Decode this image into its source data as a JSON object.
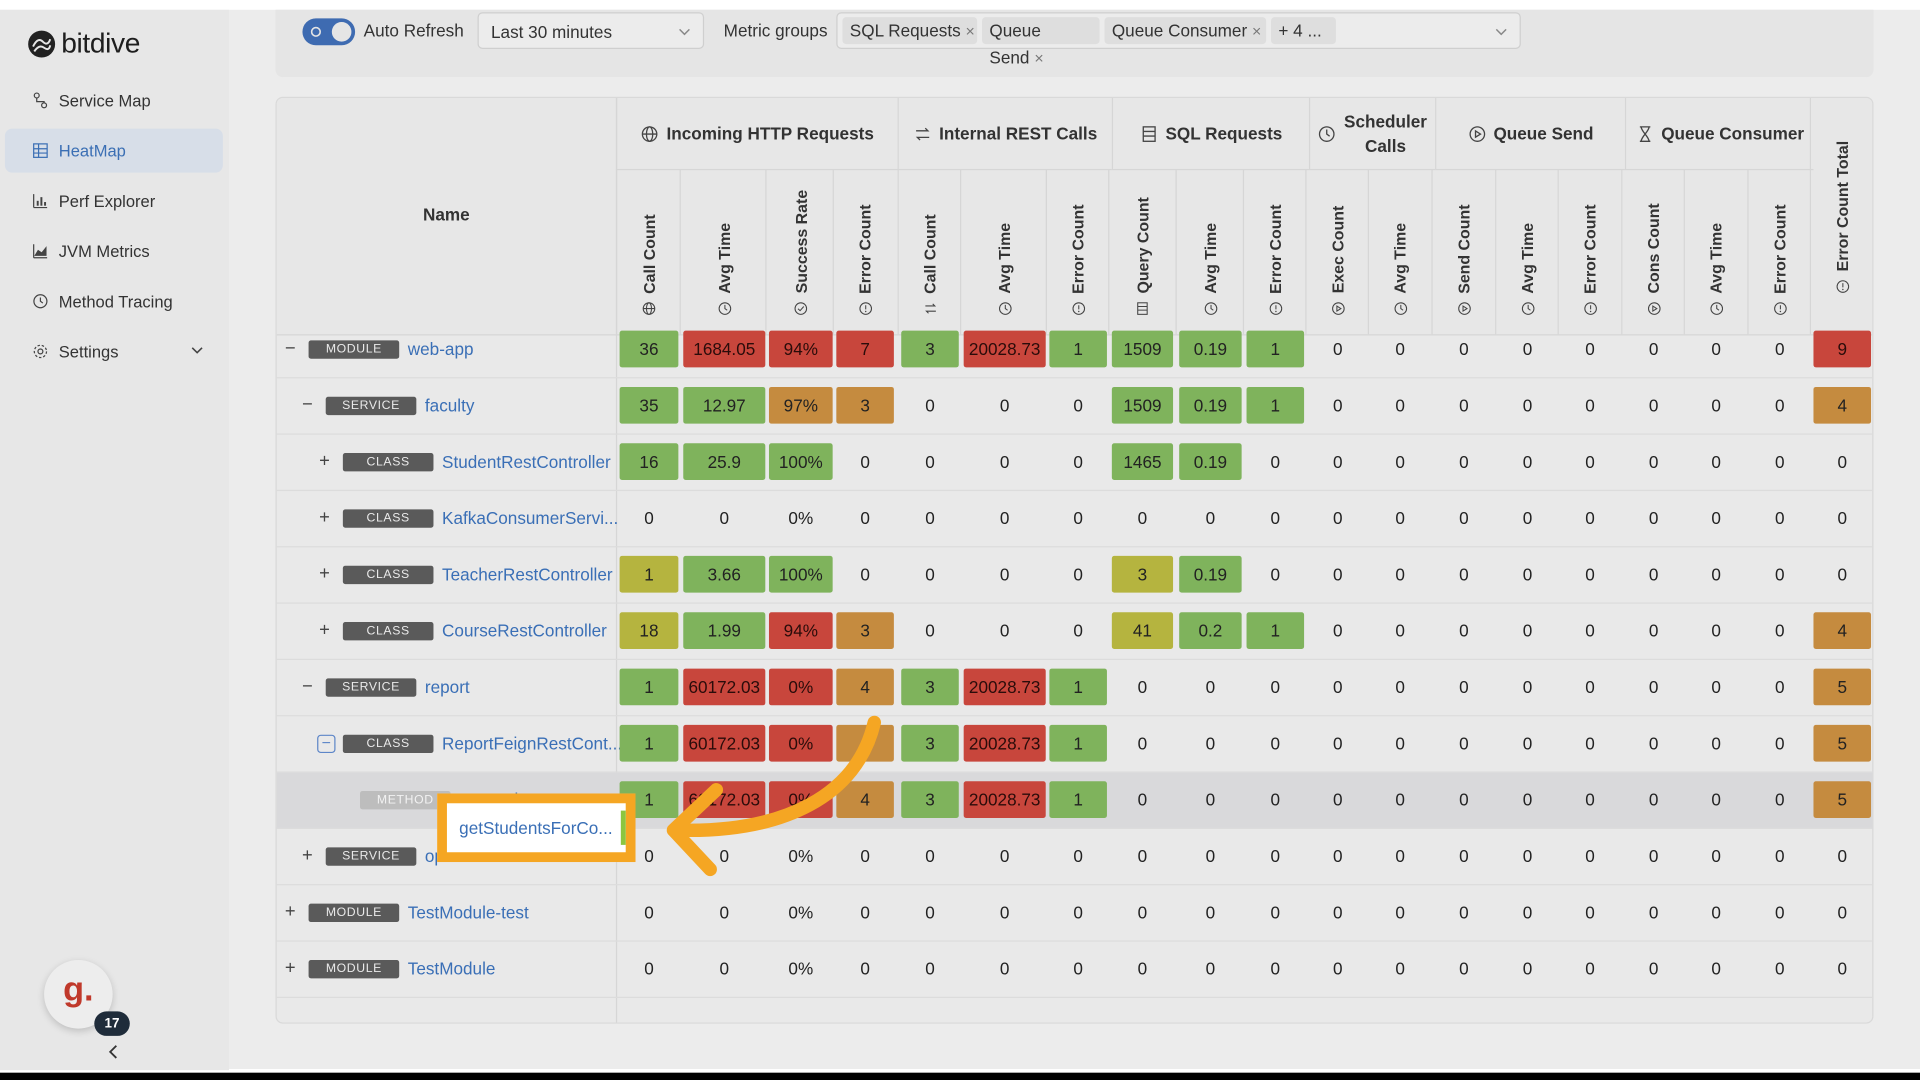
{
  "app": {
    "name": "bitdive"
  },
  "sidebar": {
    "items": [
      {
        "label": "Service Map",
        "icon": "service-map-icon"
      },
      {
        "label": "HeatMap",
        "icon": "heatmap-icon",
        "active": true
      },
      {
        "label": "Perf Explorer",
        "icon": "bar-chart-icon"
      },
      {
        "label": "JVM Metrics",
        "icon": "area-chart-icon"
      },
      {
        "label": "Method Tracing",
        "icon": "history-icon"
      },
      {
        "label": "Settings",
        "icon": "gear-icon",
        "has_submenu": true
      }
    ],
    "avatar_letter": "g.",
    "notification_count": "17",
    "collapse_symbol": "<"
  },
  "toolbar": {
    "auto_refresh_label": "Auto Refresh",
    "auto_refresh_on": true,
    "time_range": "Last 30 minutes",
    "metric_groups_label": "Metric groups",
    "metric_group_tags": [
      "SQL Requests",
      "Queue Send",
      "Queue Consumer"
    ],
    "more_tags": "+ 4 ..."
  },
  "table": {
    "name_header": "Name",
    "groups": [
      {
        "label": "Incoming HTTP Requests",
        "icon": "globe-icon"
      },
      {
        "label": "Internal REST Calls",
        "icon": "swap-icon"
      },
      {
        "label": "SQL Requests",
        "icon": "database-icon"
      },
      {
        "label": "Scheduler Calls",
        "icon": "clock-icon"
      },
      {
        "label": "Queue Send",
        "icon": "play-circle-icon"
      },
      {
        "label": "Queue Consumer",
        "icon": "hourglass-icon"
      }
    ],
    "columns": [
      {
        "label": "Call Count",
        "icon": "globe-icon"
      },
      {
        "label": "Avg Time",
        "icon": "clock-icon"
      },
      {
        "label": "Success Rate",
        "icon": "check-circle-icon"
      },
      {
        "label": "Error Count",
        "icon": "alert-circle-icon"
      },
      {
        "label": "Call Count",
        "icon": "swap-icon"
      },
      {
        "label": "Avg Time",
        "icon": "clock-icon"
      },
      {
        "label": "Error Count",
        "icon": "alert-circle-icon"
      },
      {
        "label": "Query Count",
        "icon": "database-icon"
      },
      {
        "label": "Avg Time",
        "icon": "clock-icon"
      },
      {
        "label": "Error Count",
        "icon": "alert-circle-icon"
      },
      {
        "label": "Exec Count",
        "icon": "play-circle-icon"
      },
      {
        "label": "Avg Time",
        "icon": "clock-icon"
      },
      {
        "label": "Send Count",
        "icon": "play-circle-icon"
      },
      {
        "label": "Avg Time",
        "icon": "clock-icon"
      },
      {
        "label": "Error Count",
        "icon": "alert-circle-icon"
      },
      {
        "label": "Cons Count",
        "icon": "play-circle-icon"
      },
      {
        "label": "Avg Time",
        "icon": "clock-icon"
      },
      {
        "label": "Error Count",
        "icon": "alert-circle-icon"
      },
      {
        "label": "Error Count Total",
        "icon": "alert-circle-icon"
      }
    ],
    "rows": [
      {
        "expander": "−",
        "type": "MODULE",
        "name": "web-app",
        "values": [
          "36",
          "1684.05",
          "94%",
          "7",
          "3",
          "20028.73",
          "1",
          "1509",
          "0.19",
          "1",
          "0",
          "0",
          "0",
          "0",
          "0",
          "0",
          "0",
          "0",
          "9"
        ],
        "colors": [
          "g",
          "r",
          "r",
          "r",
          "g",
          "r",
          "g",
          "g",
          "g",
          "g",
          "",
          "",
          "",
          "",
          "",
          "",
          "",
          "",
          "r"
        ]
      },
      {
        "expander": "−",
        "type": "SERVICE",
        "name": "faculty",
        "values": [
          "35",
          "12.97",
          "97%",
          "3",
          "0",
          "0",
          "0",
          "1509",
          "0.19",
          "1",
          "0",
          "0",
          "0",
          "0",
          "0",
          "0",
          "0",
          "0",
          "4"
        ],
        "colors": [
          "g",
          "g",
          "o",
          "o",
          "",
          "",
          "",
          "g",
          "g",
          "g",
          "",
          "",
          "",
          "",
          "",
          "",
          "",
          "",
          "o"
        ]
      },
      {
        "expander": "+",
        "type": "CLASS",
        "name": "StudentRestController",
        "values": [
          "16",
          "25.9",
          "100%",
          "0",
          "0",
          "0",
          "0",
          "1465",
          "0.19",
          "0",
          "0",
          "0",
          "0",
          "0",
          "0",
          "0",
          "0",
          "0",
          "0"
        ],
        "colors": [
          "g",
          "g",
          "g",
          "",
          "",
          "",
          "",
          "g",
          "g",
          "",
          "",
          "",
          "",
          "",
          "",
          "",
          "",
          "",
          ""
        ]
      },
      {
        "expander": "+",
        "type": "CLASS",
        "name": "KafkaConsumerServi...",
        "values": [
          "0",
          "0",
          "0%",
          "0",
          "0",
          "0",
          "0",
          "0",
          "0",
          "0",
          "0",
          "0",
          "0",
          "0",
          "0",
          "0",
          "0",
          "0",
          "0"
        ],
        "colors": [
          "",
          "",
          "",
          "",
          "",
          "",
          "",
          "",
          "",
          "",
          "",
          "",
          "",
          "",
          "",
          "",
          "",
          "",
          ""
        ]
      },
      {
        "expander": "+",
        "type": "CLASS",
        "name": "TeacherRestController",
        "values": [
          "1",
          "3.66",
          "100%",
          "0",
          "0",
          "0",
          "0",
          "3",
          "0.19",
          "0",
          "0",
          "0",
          "0",
          "0",
          "0",
          "0",
          "0",
          "0",
          "0"
        ],
        "colors": [
          "y",
          "g",
          "g",
          "",
          "",
          "",
          "",
          "y",
          "g",
          "",
          "",
          "",
          "",
          "",
          "",
          "",
          "",
          "",
          ""
        ]
      },
      {
        "expander": "+",
        "type": "CLASS",
        "name": "CourseRestController",
        "values": [
          "18",
          "1.99",
          "94%",
          "3",
          "0",
          "0",
          "0",
          "41",
          "0.2",
          "1",
          "0",
          "0",
          "0",
          "0",
          "0",
          "0",
          "0",
          "0",
          "4"
        ],
        "colors": [
          "y",
          "g",
          "r",
          "o",
          "",
          "",
          "",
          "y",
          "g",
          "g",
          "",
          "",
          "",
          "",
          "",
          "",
          "",
          "",
          "o"
        ]
      },
      {
        "expander": "−",
        "type": "SERVICE",
        "name": "report",
        "values": [
          "1",
          "60172.03",
          "0%",
          "4",
          "3",
          "20028.73",
          "1",
          "0",
          "0",
          "0",
          "0",
          "0",
          "0",
          "0",
          "0",
          "0",
          "0",
          "0",
          "5"
        ],
        "colors": [
          "g",
          "r",
          "r",
          "o",
          "g",
          "r",
          "g",
          "",
          "",
          "",
          "",
          "",
          "",
          "",
          "",
          "",
          "",
          "",
          "o"
        ]
      },
      {
        "expander": "−",
        "type": "CLASS",
        "name": "ReportFeignRestCont...",
        "values": [
          "1",
          "60172.03",
          "0%",
          "4",
          "3",
          "20028.73",
          "1",
          "0",
          "0",
          "0",
          "0",
          "0",
          "0",
          "0",
          "0",
          "0",
          "0",
          "0",
          "5"
        ],
        "colors": [
          "g",
          "r",
          "r",
          "o",
          "g",
          "r",
          "g",
          "",
          "",
          "",
          "",
          "",
          "",
          "",
          "",
          "",
          "",
          "",
          "o"
        ]
      },
      {
        "expander": "",
        "type": "METHOD",
        "name": "getStudentsForCo...",
        "values": [
          "1",
          "60172.03",
          "0%",
          "4",
          "3",
          "20028.73",
          "1",
          "0",
          "0",
          "0",
          "0",
          "0",
          "0",
          "0",
          "0",
          "0",
          "0",
          "0",
          "5"
        ],
        "colors": [
          "g",
          "r",
          "r",
          "o",
          "g",
          "r",
          "g",
          "",
          "",
          "",
          "",
          "",
          "",
          "",
          "",
          "",
          "",
          "",
          "o"
        ]
      },
      {
        "expander": "+",
        "type": "SERVICE",
        "name": "open-ai",
        "values": [
          "0",
          "0",
          "0%",
          "0",
          "0",
          "0",
          "0",
          "0",
          "0",
          "0",
          "0",
          "0",
          "0",
          "0",
          "0",
          "0",
          "0",
          "0",
          "0"
        ],
        "colors": [
          "",
          "",
          "",
          "",
          "",
          "",
          "",
          "",
          "",
          "",
          "",
          "",
          "",
          "",
          "",
          "",
          "",
          "",
          ""
        ]
      },
      {
        "expander": "+",
        "type": "MODULE",
        "name": "TestModule-test",
        "values": [
          "0",
          "0",
          "0%",
          "0",
          "0",
          "0",
          "0",
          "0",
          "0",
          "0",
          "0",
          "0",
          "0",
          "0",
          "0",
          "0",
          "0",
          "0",
          "0"
        ],
        "colors": [
          "",
          "",
          "",
          "",
          "",
          "",
          "",
          "",
          "",
          "",
          "",
          "",
          "",
          "",
          "",
          "",
          "",
          "",
          ""
        ]
      },
      {
        "expander": "+",
        "type": "MODULE",
        "name": "TestModule",
        "values": [
          "0",
          "0",
          "0%",
          "0",
          "0",
          "0",
          "0",
          "0",
          "0",
          "0",
          "0",
          "0",
          "0",
          "0",
          "0",
          "0",
          "0",
          "0",
          "0"
        ],
        "colors": [
          "",
          "",
          "",
          "",
          "",
          "",
          "",
          "",
          "",
          "",
          "",
          "",
          "",
          "",
          "",
          "",
          "",
          "",
          ""
        ]
      }
    ]
  },
  "callout": {
    "text": "getStudentsForCo..."
  },
  "palette": {
    "g": "#7fb35c",
    "r": "#c8463c",
    "o": "#c58b3f",
    "y": "#b5b43f",
    "neutral": "#e0e0e0"
  }
}
